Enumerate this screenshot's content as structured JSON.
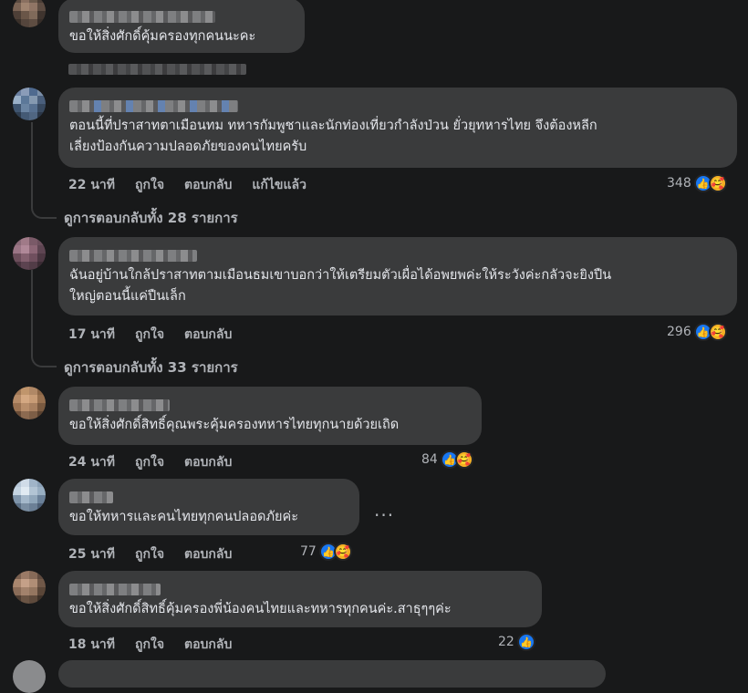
{
  "labels": {
    "like": "ถูกใจ",
    "reply": "ตอบกลับ",
    "edited": "แก้ไขแล้ว"
  },
  "comments": [
    {
      "text": "ขอให้สิ่งศักดิ์คุ้มครองทุกคนนะคะ",
      "time": "",
      "reactions": ""
    },
    {
      "text": "ตอนนี้ที่ปราสาทตาเมือนทม ทหารกัมพูชาและนักท่องเที่ยวกำลังป่วน ยั่วยุทหารไทย จึงต้องหลีก\nเลี่ยงป้องกันความปลอดภัยของคนไทยครับ",
      "time": "22 นาที",
      "reactions": "348"
    },
    {
      "text": "ฉันอยู่บ้านใกล้ปราสาทตามเมือนธมเขาบอกว่าให้เตรียมตัวเผื่อได้อพยพค่ะให้ระวังค่ะกลัวจะยิงปืน\nใหญ่ตอนนี้แค่ปืนเล็ก",
      "time": "17 นาที",
      "reactions": "296"
    },
    {
      "text": "ขอให้สิ่งศักดิ์สิทธิ์คุณพระคุ้มครองทหารไทยทุกนายด้วยเถิด",
      "time": "24 นาที",
      "reactions": "84"
    },
    {
      "text": "ขอให้ทหารและคนไทยทุกคนปลอดภัยค่ะ",
      "time": "25 นาที",
      "reactions": "77"
    },
    {
      "text": "ขอให้สิ่งศักดิ์สิทธิ์คุ้มครองพี่น้องคนไทยและทหารทุกคนค่ะ.สาธุๆๆค่ะ",
      "time": "18 นาที",
      "reactions": "22"
    }
  ],
  "view_replies": [
    "ดูการตอบกลับทั้ง 28 รายการ",
    "ดูการตอบกลับทั้ง 33 รายการ"
  ],
  "more_options": "...",
  "colors": {
    "background": "#18191a",
    "bubble": "#3a3b3c",
    "text": "#e4e6eb",
    "muted": "#b0b3b8",
    "like": "#1877f2",
    "care": "#f7b125"
  },
  "icons": {
    "like": "like-icon",
    "care": "care-icon"
  }
}
